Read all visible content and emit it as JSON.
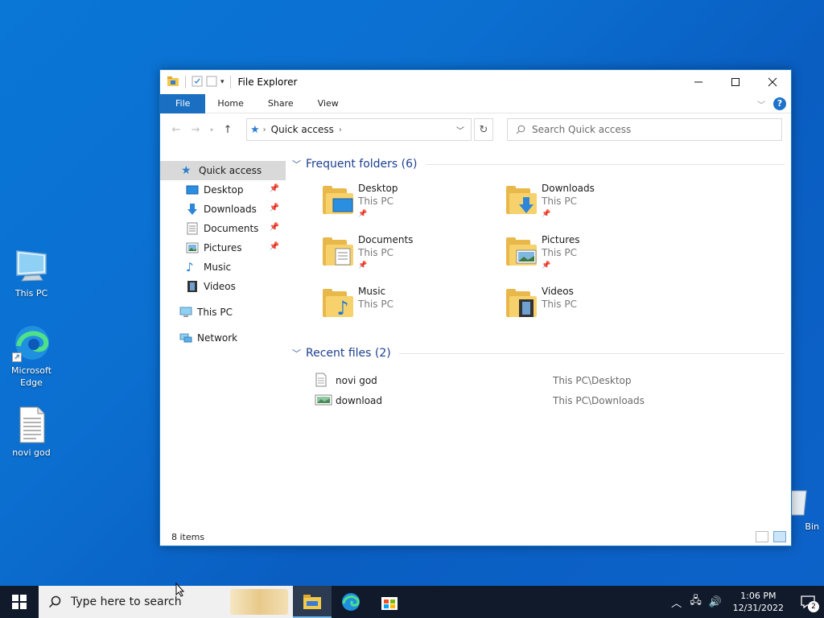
{
  "desktop": {
    "icons": [
      {
        "label": "This PC"
      },
      {
        "label": "Microsoft Edge"
      },
      {
        "label": "novi god"
      },
      {
        "label": "Bin"
      }
    ]
  },
  "window": {
    "title": "File Explorer",
    "ribbon_tabs": [
      "File",
      "Home",
      "Share",
      "View"
    ],
    "address": {
      "crumb": "Quick access"
    },
    "search_placeholder": "Search Quick access",
    "help_label": "?"
  },
  "nav_pane": {
    "quick_access": "Quick access",
    "items": [
      {
        "label": "Desktop",
        "pinned": true
      },
      {
        "label": "Downloads",
        "pinned": true
      },
      {
        "label": "Documents",
        "pinned": true
      },
      {
        "label": "Pictures",
        "pinned": true
      },
      {
        "label": "Music",
        "pinned": false
      },
      {
        "label": "Videos",
        "pinned": false
      }
    ],
    "this_pc": "This PC",
    "network": "Network"
  },
  "content": {
    "frequent_header": "Frequent folders (6)",
    "frequent": [
      {
        "name": "Desktop",
        "location": "This PC",
        "pinned": true
      },
      {
        "name": "Downloads",
        "location": "This PC",
        "pinned": true
      },
      {
        "name": "Documents",
        "location": "This PC",
        "pinned": true
      },
      {
        "name": "Pictures",
        "location": "This PC",
        "pinned": true
      },
      {
        "name": "Music",
        "location": "This PC",
        "pinned": false
      },
      {
        "name": "Videos",
        "location": "This PC",
        "pinned": false
      }
    ],
    "recent_header": "Recent files (2)",
    "recent": [
      {
        "name": "novi god",
        "path": "This PC\\Desktop"
      },
      {
        "name": "download",
        "path": "This PC\\Downloads"
      }
    ]
  },
  "status": {
    "items": "8 items"
  },
  "taskbar": {
    "search_placeholder": "Type here to search",
    "time": "1:06 PM",
    "date": "12/31/2022",
    "notifications": "2"
  },
  "colors": {
    "accent": "#1a6fc2",
    "folder": "#f7d26c",
    "taskbar": "#101a2b"
  }
}
